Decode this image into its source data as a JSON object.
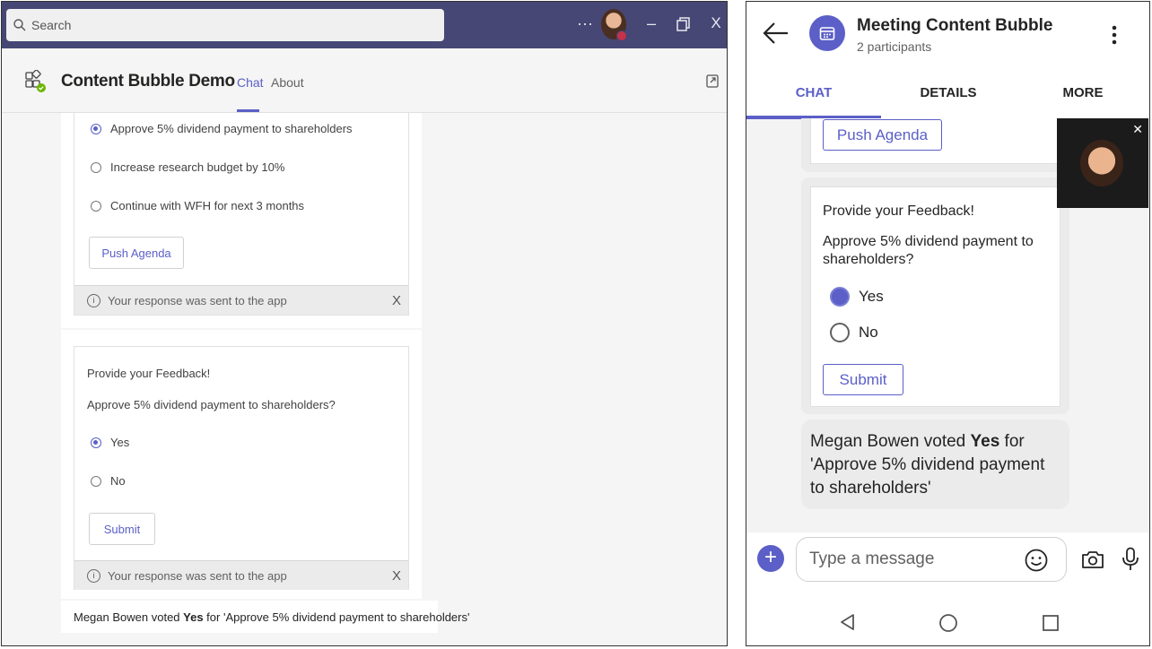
{
  "desktop": {
    "search_placeholder": "Search",
    "title_controls": {
      "more": "···",
      "minimize": "–",
      "close": "X"
    },
    "app_title": "Content Bubble Demo",
    "tabs": [
      {
        "label": "Chat",
        "active": true
      },
      {
        "label": "About",
        "active": false
      }
    ],
    "agenda_card": {
      "options": [
        {
          "label": "Approve 5% dividend payment to shareholders",
          "selected": true
        },
        {
          "label": "Increase research budget by 10%",
          "selected": false
        },
        {
          "label": "Continue with WFH for next 3 months",
          "selected": false
        }
      ],
      "button_label": "Push Agenda",
      "toast_text": "Your response was sent to the app",
      "toast_close": "X"
    },
    "feedback_card": {
      "heading": "Provide your Feedback!",
      "question": "Approve 5% dividend payment to shareholders?",
      "options": [
        {
          "label": "Yes",
          "selected": true
        },
        {
          "label": "No",
          "selected": false
        }
      ],
      "button_label": "Submit",
      "toast_text": "Your response was sent to the app",
      "toast_close": "X"
    },
    "vote_message": {
      "prefix": "Megan Bowen voted ",
      "choice": "Yes",
      "suffix": " for 'Approve 5% dividend payment to shareholders'"
    }
  },
  "mobile": {
    "title": "Meeting Content Bubble",
    "subtitle": "2 participants",
    "tabs": [
      {
        "label": "CHAT",
        "active": true
      },
      {
        "label": "DETAILS",
        "active": false
      },
      {
        "label": "MORE",
        "active": false
      }
    ],
    "agenda_button": "Push Agenda",
    "feedback_card": {
      "heading": "Provide your Feedback!",
      "question": "Approve 5% dividend payment to shareholders?",
      "options": [
        {
          "label": "Yes",
          "selected": true
        },
        {
          "label": "No",
          "selected": false
        }
      ],
      "button_label": "Submit"
    },
    "vote_message": {
      "prefix": "Megan Bowen voted ",
      "choice": "Yes",
      "suffix": " for 'Approve 5% dividend payment to shareholders'"
    },
    "pip_close": "✕",
    "compose_placeholder": "Type a message",
    "compose_plus": "+"
  },
  "colors": {
    "accent": "#5b5fc7",
    "titlebar": "#464775"
  }
}
